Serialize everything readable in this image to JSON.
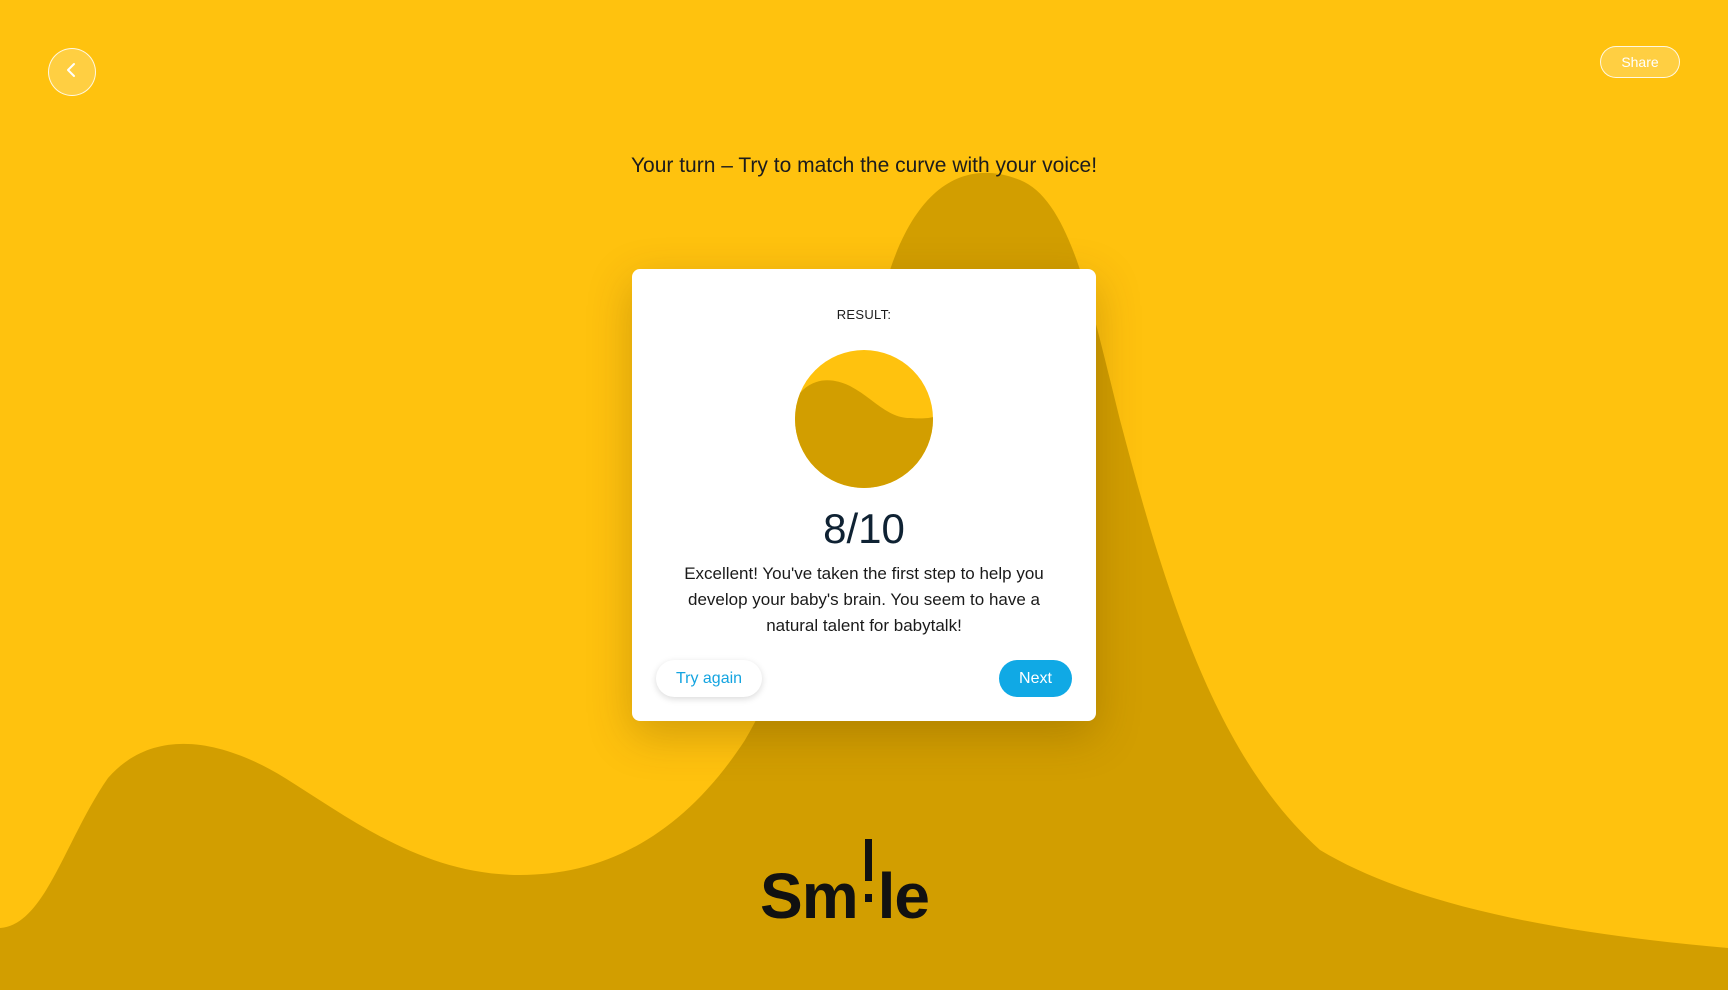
{
  "header": {
    "back_icon": "chevron-left-icon",
    "share_label": "Share"
  },
  "instruction": "Your turn – Try to match the curve with your voice!",
  "result": {
    "label": "RESULT:",
    "score_graphic_icon": "wave-badge-icon",
    "score": "8/10",
    "score_value": 8,
    "score_max": 10,
    "message": "Excellent! You've taken the first step to help you develop your baby's brain. You seem to have a natural talent for babytalk!",
    "try_again_label": "Try again",
    "next_label": "Next"
  },
  "logo": {
    "text": "Smile",
    "part_1": "Sm",
    "part_2": "le"
  },
  "colors": {
    "background": "#FFC20E",
    "curve": "#D29E00",
    "accent": "#10A9E5",
    "text_dark": "#0F2233"
  }
}
